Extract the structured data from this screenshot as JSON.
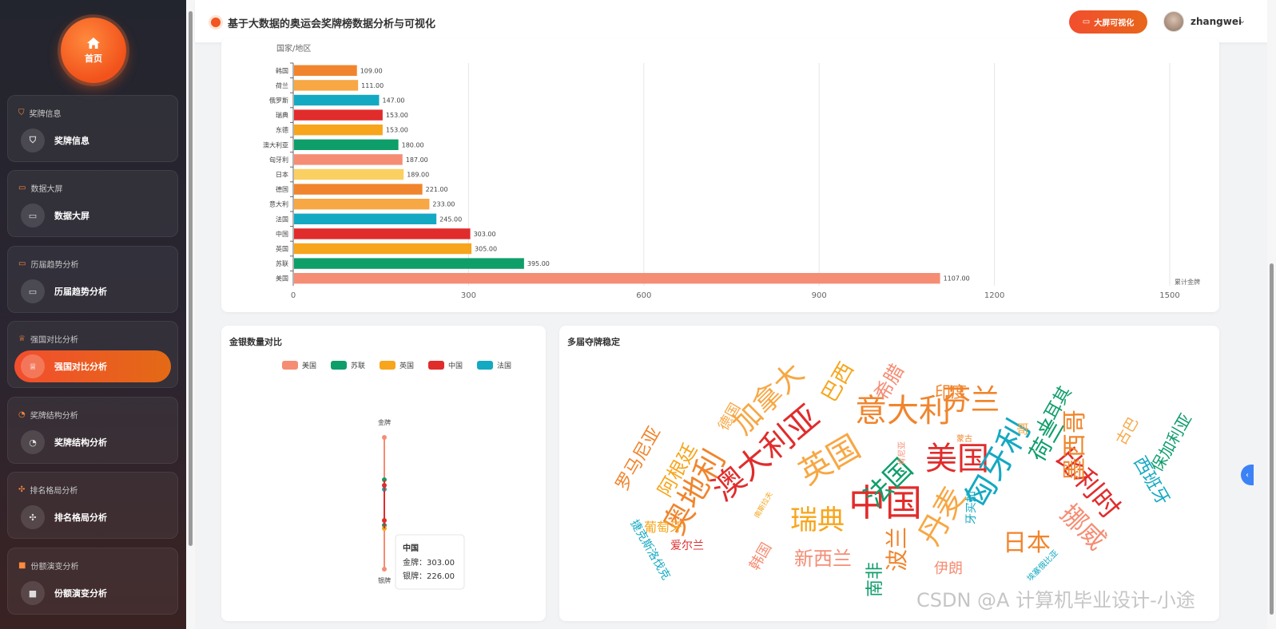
{
  "sidebar": {
    "home_label": "首页",
    "groups": [
      {
        "category": "奖牌信息",
        "item": "奖牌信息"
      },
      {
        "category": "数据大屏",
        "item": "数据大屏"
      },
      {
        "category": "历届趋势分析",
        "item": "历届趋势分析"
      },
      {
        "category": "强国对比分析",
        "item": "强国对比分析"
      },
      {
        "category": "奖牌结构分析",
        "item": "奖牌结构分析"
      },
      {
        "category": "排名格局分析",
        "item": "排名格局分析"
      },
      {
        "category": "份额演变分析",
        "item": "份额演变分析"
      }
    ]
  },
  "header": {
    "title": "基于大数据的奥运会奖牌榜数据分析与可视化",
    "bigscreen_label": "大屏可视化",
    "username": "zhangwei"
  },
  "colors": {
    "accent": "#f2521b",
    "palette": [
      "#f0852d",
      "#f7a744",
      "#14a9c2",
      "#e12c2c",
      "#f7a51c",
      "#0e9e6a",
      "#f58d74",
      "#fbd062"
    ]
  },
  "chart_data": [
    {
      "type": "bar",
      "orientation": "horizontal",
      "ylabel": "国家/地区",
      "series_label": "累计金牌",
      "categories": [
        "韩国",
        "荷兰",
        "俄罗斯",
        "瑞典",
        "东德",
        "澳大利亚",
        "匈牙利",
        "日本",
        "德国",
        "意大利",
        "法国",
        "中国",
        "英国",
        "苏联",
        "美国"
      ],
      "values": [
        109,
        111,
        147,
        153,
        153,
        180,
        187,
        189,
        221,
        233,
        245,
        303,
        305,
        395,
        1107
      ],
      "value_labels": [
        "109.00",
        "111.00",
        "147.00",
        "153.00",
        "153.00",
        "180.00",
        "187.00",
        "189.00",
        "221.00",
        "233.00",
        "245.00",
        "303.00",
        "305.00",
        "395.00",
        "1107.00"
      ],
      "bar_colors": [
        "#f0852d",
        "#f7a744",
        "#14a9c2",
        "#e12c2c",
        "#f7a51c",
        "#0e9e6a",
        "#f58d74",
        "#fbd062",
        "#f0852d",
        "#f7a744",
        "#14a9c2",
        "#e12c2c",
        "#f7a51c",
        "#0e9e6a",
        "#f58d74"
      ],
      "xlim": [
        0,
        1500
      ],
      "xticks": [
        0,
        300,
        600,
        900,
        1200,
        1500
      ],
      "grid": true
    },
    {
      "type": "radar",
      "title": "金银数量对比",
      "legend": [
        "美国",
        "苏联",
        "英国",
        "中国",
        "法国"
      ],
      "legend_colors": [
        "#f58d74",
        "#0e9e6a",
        "#f7a51c",
        "#e12c2c",
        "#14a9c2"
      ],
      "indicators": [
        "金牌",
        "银牌"
      ],
      "tooltip": {
        "name": "中国",
        "rows": [
          {
            "label": "金牌",
            "value": "303.00"
          },
          {
            "label": "银牌",
            "value": "226.00"
          }
        ]
      }
    }
  ],
  "cloud": {
    "title": "多届夺牌稳定",
    "words": [
      {
        "text": "美国",
        "color": "#e12c2c"
      },
      {
        "text": "中国",
        "color": "#e12c2c"
      },
      {
        "text": "英国",
        "color": "#f7a744"
      },
      {
        "text": "法国",
        "color": "#0e9e6a"
      },
      {
        "text": "意大利",
        "color": "#f0852d"
      },
      {
        "text": "澳大利亚",
        "color": "#e12c2c"
      },
      {
        "text": "匈牙利",
        "color": "#14a9c2"
      },
      {
        "text": "瑞典",
        "color": "#f7a51c"
      },
      {
        "text": "日本",
        "color": "#f0852d"
      },
      {
        "text": "加拿大",
        "color": "#f7a744"
      },
      {
        "text": "芬兰",
        "color": "#f0852d"
      },
      {
        "text": "比利时",
        "color": "#e12c2c"
      },
      {
        "text": "荷兰",
        "color": "#0e9e6a"
      },
      {
        "text": "奥地利",
        "color": "#f0852d"
      },
      {
        "text": "丹麦",
        "color": "#f7a744"
      },
      {
        "text": "挪威",
        "color": "#f58d74"
      },
      {
        "text": "新西兰",
        "color": "#f58d74"
      },
      {
        "text": "巴西",
        "color": "#f7a51c"
      },
      {
        "text": "波兰",
        "color": "#f0852d"
      },
      {
        "text": "墨西哥",
        "color": "#f0852d"
      },
      {
        "text": "阿根廷",
        "color": "#f7a51c"
      },
      {
        "text": "希腊",
        "color": "#f58d74"
      },
      {
        "text": "罗马尼亚",
        "color": "#f0852d"
      },
      {
        "text": "土耳其",
        "color": "#0e9e6a"
      },
      {
        "text": "印度",
        "color": "#f0852d"
      },
      {
        "text": "德国",
        "color": "#f7a744"
      },
      {
        "text": "西班牙",
        "color": "#14a9c2"
      },
      {
        "text": "保加利亚",
        "color": "#0e9e6a"
      },
      {
        "text": "古巴",
        "color": "#f7a744"
      },
      {
        "text": "伊朗",
        "color": "#f58d74"
      },
      {
        "text": "南非",
        "color": "#0e9e6a"
      },
      {
        "text": "韩国",
        "color": "#f58d74"
      },
      {
        "text": "葡萄牙",
        "color": "#f7a51c"
      },
      {
        "text": "爱尔兰",
        "color": "#e12c2c"
      },
      {
        "text": "捷克斯洛伐克",
        "color": "#14a9c2"
      },
      {
        "text": "牙买加",
        "color": "#14a9c2"
      },
      {
        "text": "蒙古",
        "color": "#f0852d"
      },
      {
        "text": "肯尼亚",
        "color": "#f58d74"
      },
      {
        "text": "南斯拉夫",
        "color": "#f7a51c"
      },
      {
        "text": "埃塞俄比亚",
        "color": "#14a9c2"
      },
      {
        "text": "哥",
        "color": "#f7a744"
      }
    ]
  },
  "watermark": "CSDN @A 计算机毕业设计-小途"
}
